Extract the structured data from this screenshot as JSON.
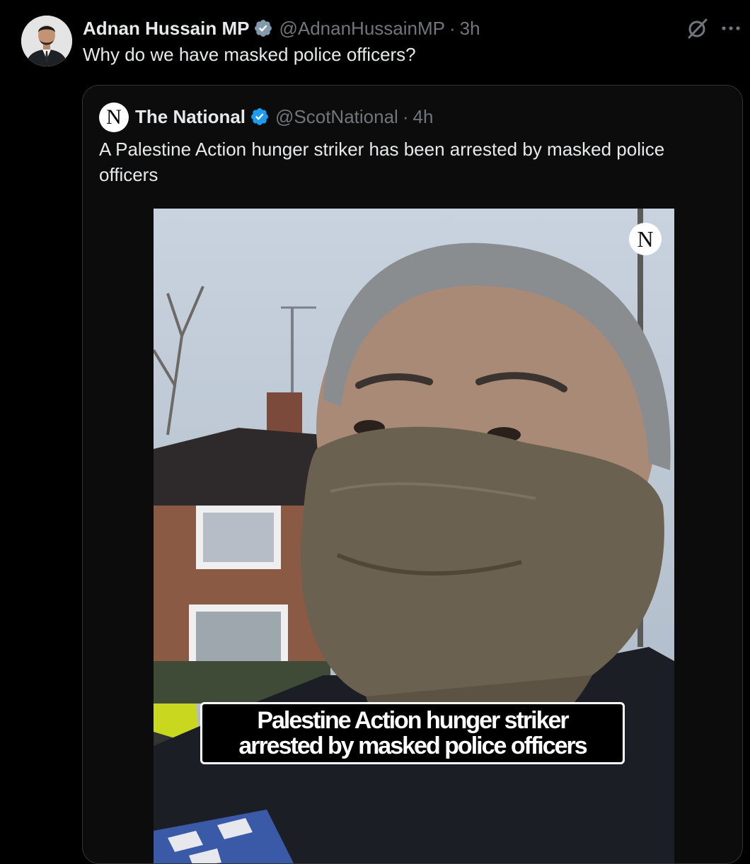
{
  "tweet": {
    "author_name": "Adnan Hussain MP",
    "handle": "@AdnanHussainMP",
    "separator": "·",
    "time": "3h",
    "text": "Why do we have masked police officers?",
    "icons": {
      "verified": "verified-badge-icon",
      "grok": "grok-icon",
      "more": "more-options-icon"
    }
  },
  "quote": {
    "logo_letter": "N",
    "author_name": "The National",
    "handle": "@ScotNational",
    "separator": "·",
    "time": "4h",
    "text": "A Palestine Action hunger striker has been arrested by masked police officers",
    "media": {
      "watermark_letter": "N",
      "caption_line1": "Palestine Action hunger striker",
      "caption_line2": "arrested by masked police officers"
    }
  },
  "colors": {
    "background": "#000000",
    "text": "#e7e9ea",
    "secondary_text": "#71767b",
    "verified_grey": "#829aab",
    "verified_blue": "#1d9bf0",
    "card_border": "#2f3336"
  }
}
